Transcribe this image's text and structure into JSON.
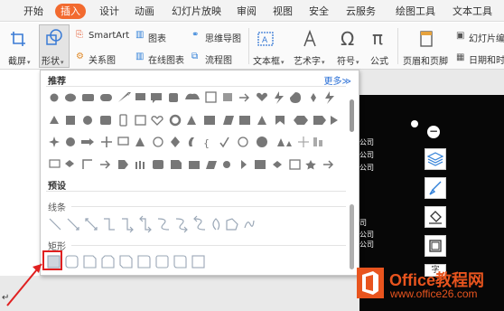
{
  "tabs": [
    "开始",
    "插入",
    "设计",
    "动画",
    "幻灯片放映",
    "审阅",
    "视图",
    "安全",
    "云服务",
    "绘图工具",
    "文本工具"
  ],
  "active_tab": "插入",
  "ribbon": {
    "screenshot": "截屏",
    "shapes": "形状",
    "smartart": "SmartArt",
    "chart": "图表",
    "mindmap": "思维导图",
    "relation": "关系图",
    "online_chart": "在线图表",
    "flowchart": "流程图",
    "textbox": "文本框",
    "wordart": "艺术字",
    "symbol": "符号",
    "formula": "公式",
    "header_footer": "页眉和页脚",
    "slide_number": "幻灯片编",
    "datetime": "日期和时"
  },
  "panel": {
    "recommended": "推荐",
    "more": "更多≫",
    "preset": "预设",
    "lines": "线条",
    "rectangles": "矩形"
  },
  "slide": {
    "lines": [
      "公司",
      "公司",
      "公司",
      "司",
      "公司",
      "公司"
    ],
    "char": "字"
  },
  "watermark": {
    "title": "Office教程网",
    "url": "www.office26.com"
  },
  "colors": {
    "accent": "#f26a2f",
    "highlight": "#e02020",
    "watermark": "#e8541e"
  }
}
